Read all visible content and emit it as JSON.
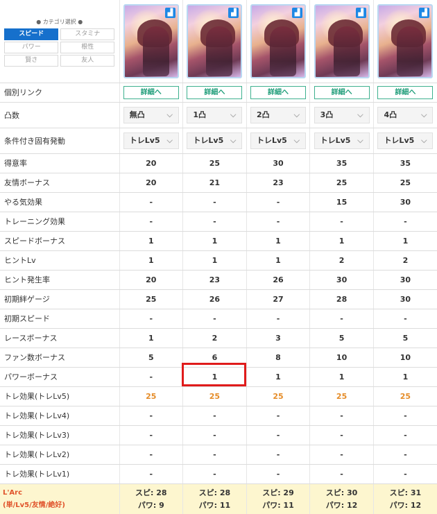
{
  "category": {
    "title": "● カテゴリ選択 ●",
    "buttons": [
      "スピード",
      "スタミナ",
      "パワー",
      "根性",
      "賢さ",
      "友人"
    ],
    "active": "スピード"
  },
  "columns": [
    "0",
    "1",
    "2",
    "3",
    "4"
  ],
  "rows": {
    "link": {
      "label": "個別リンク",
      "button": "詳細へ"
    },
    "limit_break": {
      "label": "凸数",
      "values": [
        "無凸",
        "1凸",
        "2凸",
        "3凸",
        "4凸"
      ]
    },
    "condition": {
      "label": "条件付き固有発動",
      "values": [
        "トレLv5",
        "トレLv5",
        "トレLv5",
        "トレLv5",
        "トレLv5"
      ]
    },
    "stats": [
      {
        "label": "得意率",
        "values": [
          "20",
          "25",
          "30",
          "35",
          "35"
        ]
      },
      {
        "label": "友情ボーナス",
        "values": [
          "20",
          "21",
          "23",
          "25",
          "25"
        ]
      },
      {
        "label": "やる気効果",
        "values": [
          "-",
          "-",
          "-",
          "15",
          "30"
        ]
      },
      {
        "label": "トレーニング効果",
        "values": [
          "-",
          "-",
          "-",
          "-",
          "-"
        ]
      },
      {
        "label": "スピードボーナス",
        "values": [
          "1",
          "1",
          "1",
          "1",
          "1"
        ]
      },
      {
        "label": "ヒントLv",
        "values": [
          "1",
          "1",
          "1",
          "2",
          "2"
        ]
      },
      {
        "label": "ヒント発生率",
        "values": [
          "20",
          "23",
          "26",
          "30",
          "30"
        ]
      },
      {
        "label": "初期絆ゲージ",
        "values": [
          "25",
          "26",
          "27",
          "28",
          "30"
        ]
      },
      {
        "label": "初期スピード",
        "values": [
          "-",
          "-",
          "-",
          "-",
          "-"
        ]
      },
      {
        "label": "レースボーナス",
        "values": [
          "1",
          "2",
          "3",
          "5",
          "5"
        ]
      },
      {
        "label": "ファン数ボーナス",
        "values": [
          "5",
          "6",
          "8",
          "10",
          "10"
        ]
      },
      {
        "label": "パワーボーナス",
        "values": [
          "-",
          "1",
          "1",
          "1",
          "1"
        ]
      },
      {
        "label": "トレ効果(トレLv5)",
        "values": [
          "25",
          "25",
          "25",
          "25",
          "25"
        ],
        "highlight": true
      },
      {
        "label": "トレ効果(トレLv4)",
        "values": [
          "-",
          "-",
          "-",
          "-",
          "-"
        ]
      },
      {
        "label": "トレ効果(トレLv3)",
        "values": [
          "-",
          "-",
          "-",
          "-",
          "-"
        ]
      },
      {
        "label": "トレ効果(トレLv2)",
        "values": [
          "-",
          "-",
          "-",
          "-",
          "-"
        ]
      },
      {
        "label": "トレ効果(トレLv1)",
        "values": [
          "-",
          "-",
          "-",
          "-",
          "-"
        ]
      }
    ],
    "footer": {
      "label_line1": "L'Arc",
      "label_line2": "(単/Lv5/友情/絶好)",
      "line1": [
        "スピ: 28",
        "スピ: 28",
        "スピ: 29",
        "スピ: 30",
        "スピ: 31"
      ],
      "line2": [
        "パワ: 9",
        "パワ: 11",
        "パワ: 11",
        "パワ: 12",
        "パワ: 12"
      ]
    }
  },
  "colors": {
    "accent": "#1670cc",
    "link": "#1f9d79",
    "highlight_value": "#e58c28",
    "footer_bg": "#fdf6cf",
    "footer_label": "#e0532b",
    "selection_box": "#e01b1b"
  },
  "icons": {
    "card_badge": "shoe-icon",
    "select_arrow": "chevron-down-icon"
  }
}
